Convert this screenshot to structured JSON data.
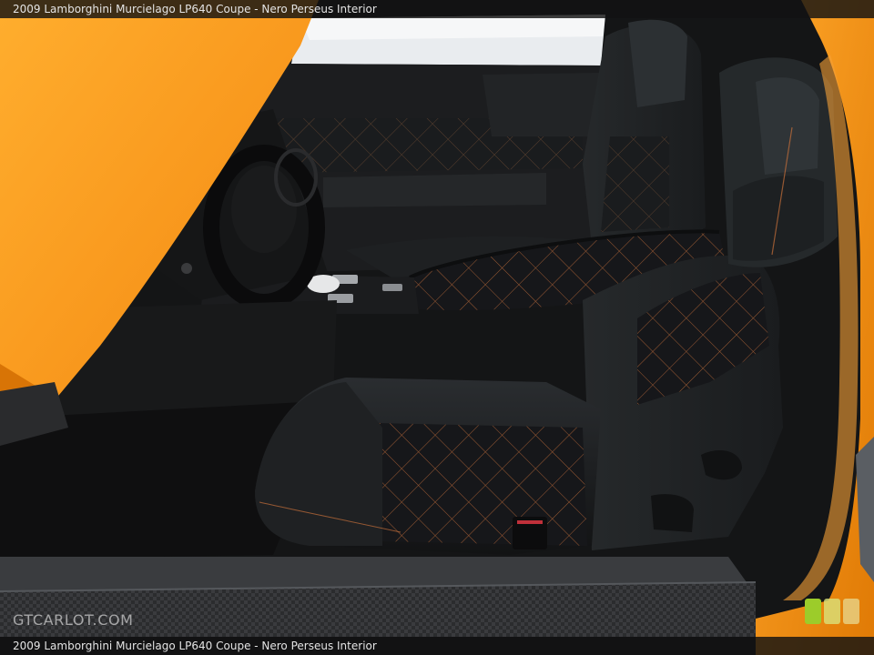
{
  "caption": {
    "top": "2009 Lamborghini Murcielago LP640 Coupe - Nero Perseus Interior",
    "bottom": "2009 Lamborghini Murcielago LP640 Coupe - Nero Perseus Interior"
  },
  "watermark": "GTCARLOT.COM",
  "colors": {
    "body_orange": "#f08a10",
    "leather": "#17181a",
    "stitching": "#c8703a",
    "carpet": "#0f0f10"
  }
}
